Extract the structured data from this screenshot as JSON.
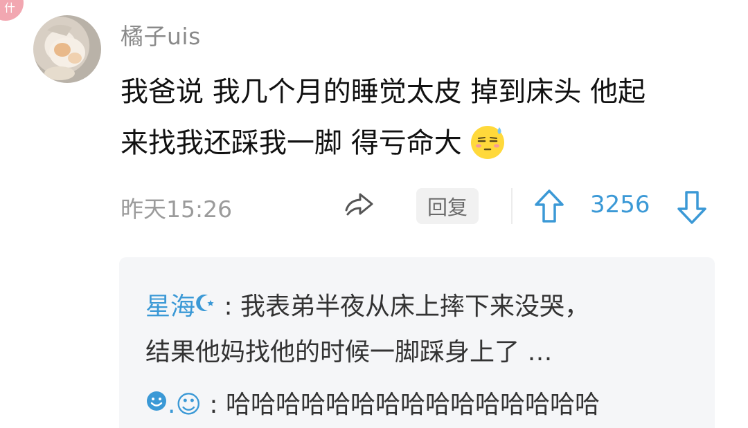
{
  "corner_badge": {
    "text": "什"
  },
  "comment": {
    "username": "橘子uis",
    "text_line1": "我爸说 我几个月的睡觉太皮 掉到床头 他起",
    "text_line2": "来找我还踩我一脚 得亏命大",
    "emoji_icon": "sweat-smile-emoji",
    "timestamp": "昨天15:26",
    "reply_label": "回复",
    "vote_count": "3256"
  },
  "replies": [
    {
      "author": "星海",
      "author_icon": "crescent-moon-icon",
      "separator": " : ",
      "text_line1": "我表弟半夜从床上摔下来没哭，",
      "text_line2": "结果他妈找他的时候一脚踩身上了 …"
    },
    {
      "author": ".☺",
      "author_icon": "smiley-icon",
      "separator": " : ",
      "text": "哈哈哈哈哈哈哈哈哈哈哈哈哈哈哈"
    }
  ],
  "colors": {
    "accent_blue": "#3b99d6",
    "text_primary": "#111111",
    "text_secondary": "#9b9b9b",
    "reply_bg": "#f5f6f8"
  }
}
